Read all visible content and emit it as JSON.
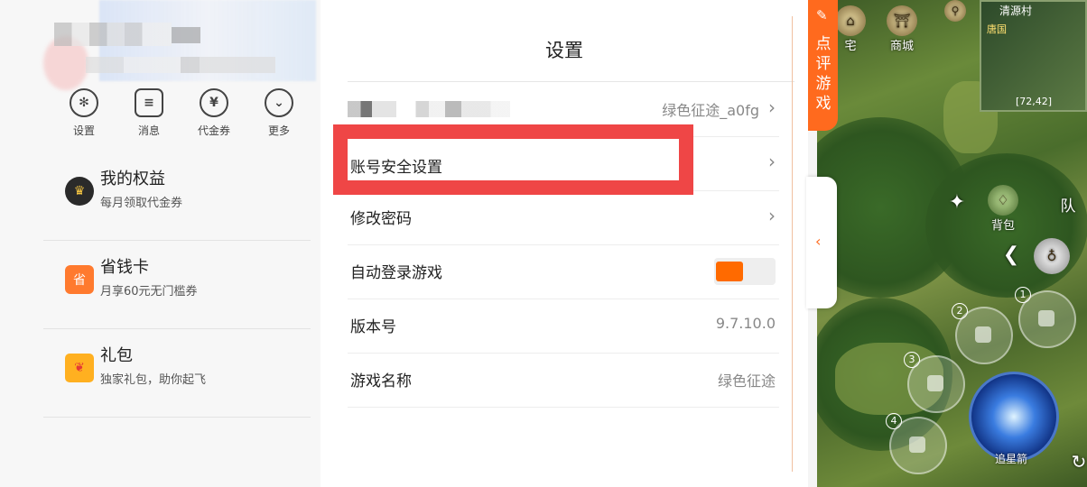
{
  "left_panel": {
    "quick_actions": [
      {
        "label": "设置",
        "icon": "gear-icon"
      },
      {
        "label": "消息",
        "icon": "message-icon"
      },
      {
        "label": "代金券",
        "icon": "coupon-icon"
      },
      {
        "label": "更多",
        "icon": "chevron-down-icon"
      }
    ],
    "menu_items": [
      {
        "title": "我的权益",
        "subtitle": "每月领取代金券",
        "icon": "crown-icon"
      },
      {
        "title": "省钱卡",
        "subtitle": "月享60元无门槛券",
        "icon": "savings-card-icon"
      },
      {
        "title": "礼包",
        "subtitle": "独家礼包，助你起飞",
        "icon": "gift-icon"
      }
    ]
  },
  "settings": {
    "title": "设置",
    "account_value": "绿色征途_a0fg",
    "rows": [
      {
        "label": "账号安全设置"
      },
      {
        "label": "修改密码"
      },
      {
        "label": "自动登录游戏",
        "toggle_on": true
      },
      {
        "label": "版本号",
        "value": "9.7.10.0"
      },
      {
        "label": "游戏名称",
        "value": "绿色征途"
      }
    ]
  },
  "review_tab": {
    "label": "点评游戏"
  },
  "game": {
    "buttons": {
      "home": "宅",
      "shop": "商城",
      "bag": "背包",
      "team": "队"
    },
    "minimap": {
      "location": "清源村",
      "area": "唐国",
      "coords": "[72,42]"
    },
    "skill_slots": [
      "1",
      "2",
      "3",
      "4"
    ],
    "main_skill": "追星箭"
  },
  "colors": {
    "accent": "#ff6a1e",
    "highlight": "#ef4646",
    "toggle": "#ff6a00"
  }
}
